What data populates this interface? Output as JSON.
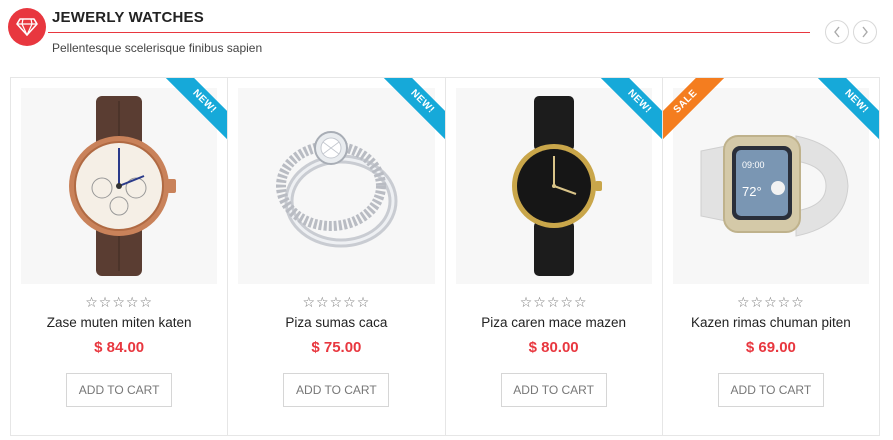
{
  "section": {
    "title": "JEWERLY WATCHES",
    "subtitle": "Pellentesque scelerisque finibus sapien",
    "accent_color": "#e8373f",
    "badge_icon": "diamond-icon",
    "prev_icon": "chevron-left-icon",
    "next_icon": "chevron-right-icon"
  },
  "products": [
    {
      "name": "Zase muten miten katen",
      "price": "$ 84.00",
      "rating": 0,
      "stars": "☆☆☆☆☆",
      "ribbon": "NEW!",
      "ribbon_type": "new",
      "cta": "ADD TO CART",
      "image": "rose-gold-chronograph-watch"
    },
    {
      "name": "Piza sumas caca",
      "price": "$ 75.00",
      "rating": 0,
      "stars": "☆☆☆☆☆",
      "ribbon": "NEW!",
      "ribbon_type": "new",
      "cta": "ADD TO CART",
      "image": "diamond-ring"
    },
    {
      "name": "Piza caren mace mazen",
      "price": "$ 80.00",
      "rating": 0,
      "stars": "☆☆☆☆☆",
      "ribbon": "NEW!",
      "ribbon_type": "new",
      "cta": "ADD TO CART",
      "image": "black-dial-leather-watch"
    },
    {
      "name": "Kazen rimas chuman piten",
      "price": "$ 69.00",
      "rating": 0,
      "stars": "☆☆☆☆☆",
      "ribbon": "NEW!",
      "ribbon_type": "new",
      "second_ribbon": "SALE",
      "cta": "ADD TO CART",
      "image": "smartwatch"
    }
  ]
}
